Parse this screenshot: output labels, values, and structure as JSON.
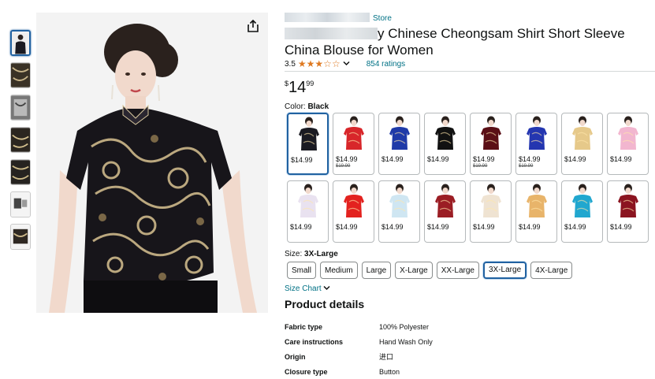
{
  "product": {
    "store_suffix": "Store",
    "title_text": "y Chinese Cheongsam Shirt Short Sleeve China Blouse for Women",
    "rating_value": "3.5",
    "stars": "★★★☆☆",
    "rating_count": "854 ratings",
    "price_currency": "$",
    "price_whole": "14",
    "price_fraction": "99",
    "color_prefix": "Color: ",
    "color_value": "Black",
    "size_prefix": "Size: ",
    "size_value": "3X-Large",
    "size_chart_label": "Size Chart",
    "details_heading": "Product details"
  },
  "swatches": [
    {
      "color": "#1a1a22",
      "price": "$14.99",
      "old": ""
    },
    {
      "color": "#d8262a",
      "price": "$14.99",
      "old": "$19.99"
    },
    {
      "color": "#1f3aa8",
      "price": "$14.99",
      "old": ""
    },
    {
      "color": "#111111",
      "price": "$14.99",
      "old": ""
    },
    {
      "color": "#5a0f16",
      "price": "$14.99",
      "old": "$19.99"
    },
    {
      "color": "#2436b0",
      "price": "$14.99",
      "old": "$19.99"
    },
    {
      "color": "#e6c98a",
      "price": "$14.99",
      "old": ""
    },
    {
      "color": "#f2b6cf",
      "price": "$14.99",
      "old": ""
    },
    {
      "color": "#e9e2f0",
      "price": "$14.99",
      "old": ""
    },
    {
      "color": "#e3221f",
      "price": "$14.99",
      "old": ""
    },
    {
      "color": "#cfe6f2",
      "price": "$14.99",
      "old": ""
    },
    {
      "color": "#9b1d24",
      "price": "$14.99",
      "old": ""
    },
    {
      "color": "#efe3d2",
      "price": "$14.99",
      "old": ""
    },
    {
      "color": "#e8b46a",
      "price": "$14.99",
      "old": ""
    },
    {
      "color": "#21a7cf",
      "price": "$14.99",
      "old": ""
    },
    {
      "color": "#8b1420",
      "price": "$14.99",
      "old": ""
    }
  ],
  "sizes": [
    "Small",
    "Medium",
    "Large",
    "X-Large",
    "XX-Large",
    "3X-Large",
    "4X-Large"
  ],
  "details": [
    {
      "k": "Fabric type",
      "v": "100% Polyester"
    },
    {
      "k": "Care instructions",
      "v": "Hand Wash Only"
    },
    {
      "k": "Origin",
      "v": "进口"
    },
    {
      "k": "Closure type",
      "v": "Button"
    }
  ],
  "colors": {
    "link": "#007185",
    "star": "#de7921",
    "selected_border": "#2162a1"
  },
  "icons": {
    "share": "share-icon",
    "dropdown": "chevron-down-icon"
  }
}
